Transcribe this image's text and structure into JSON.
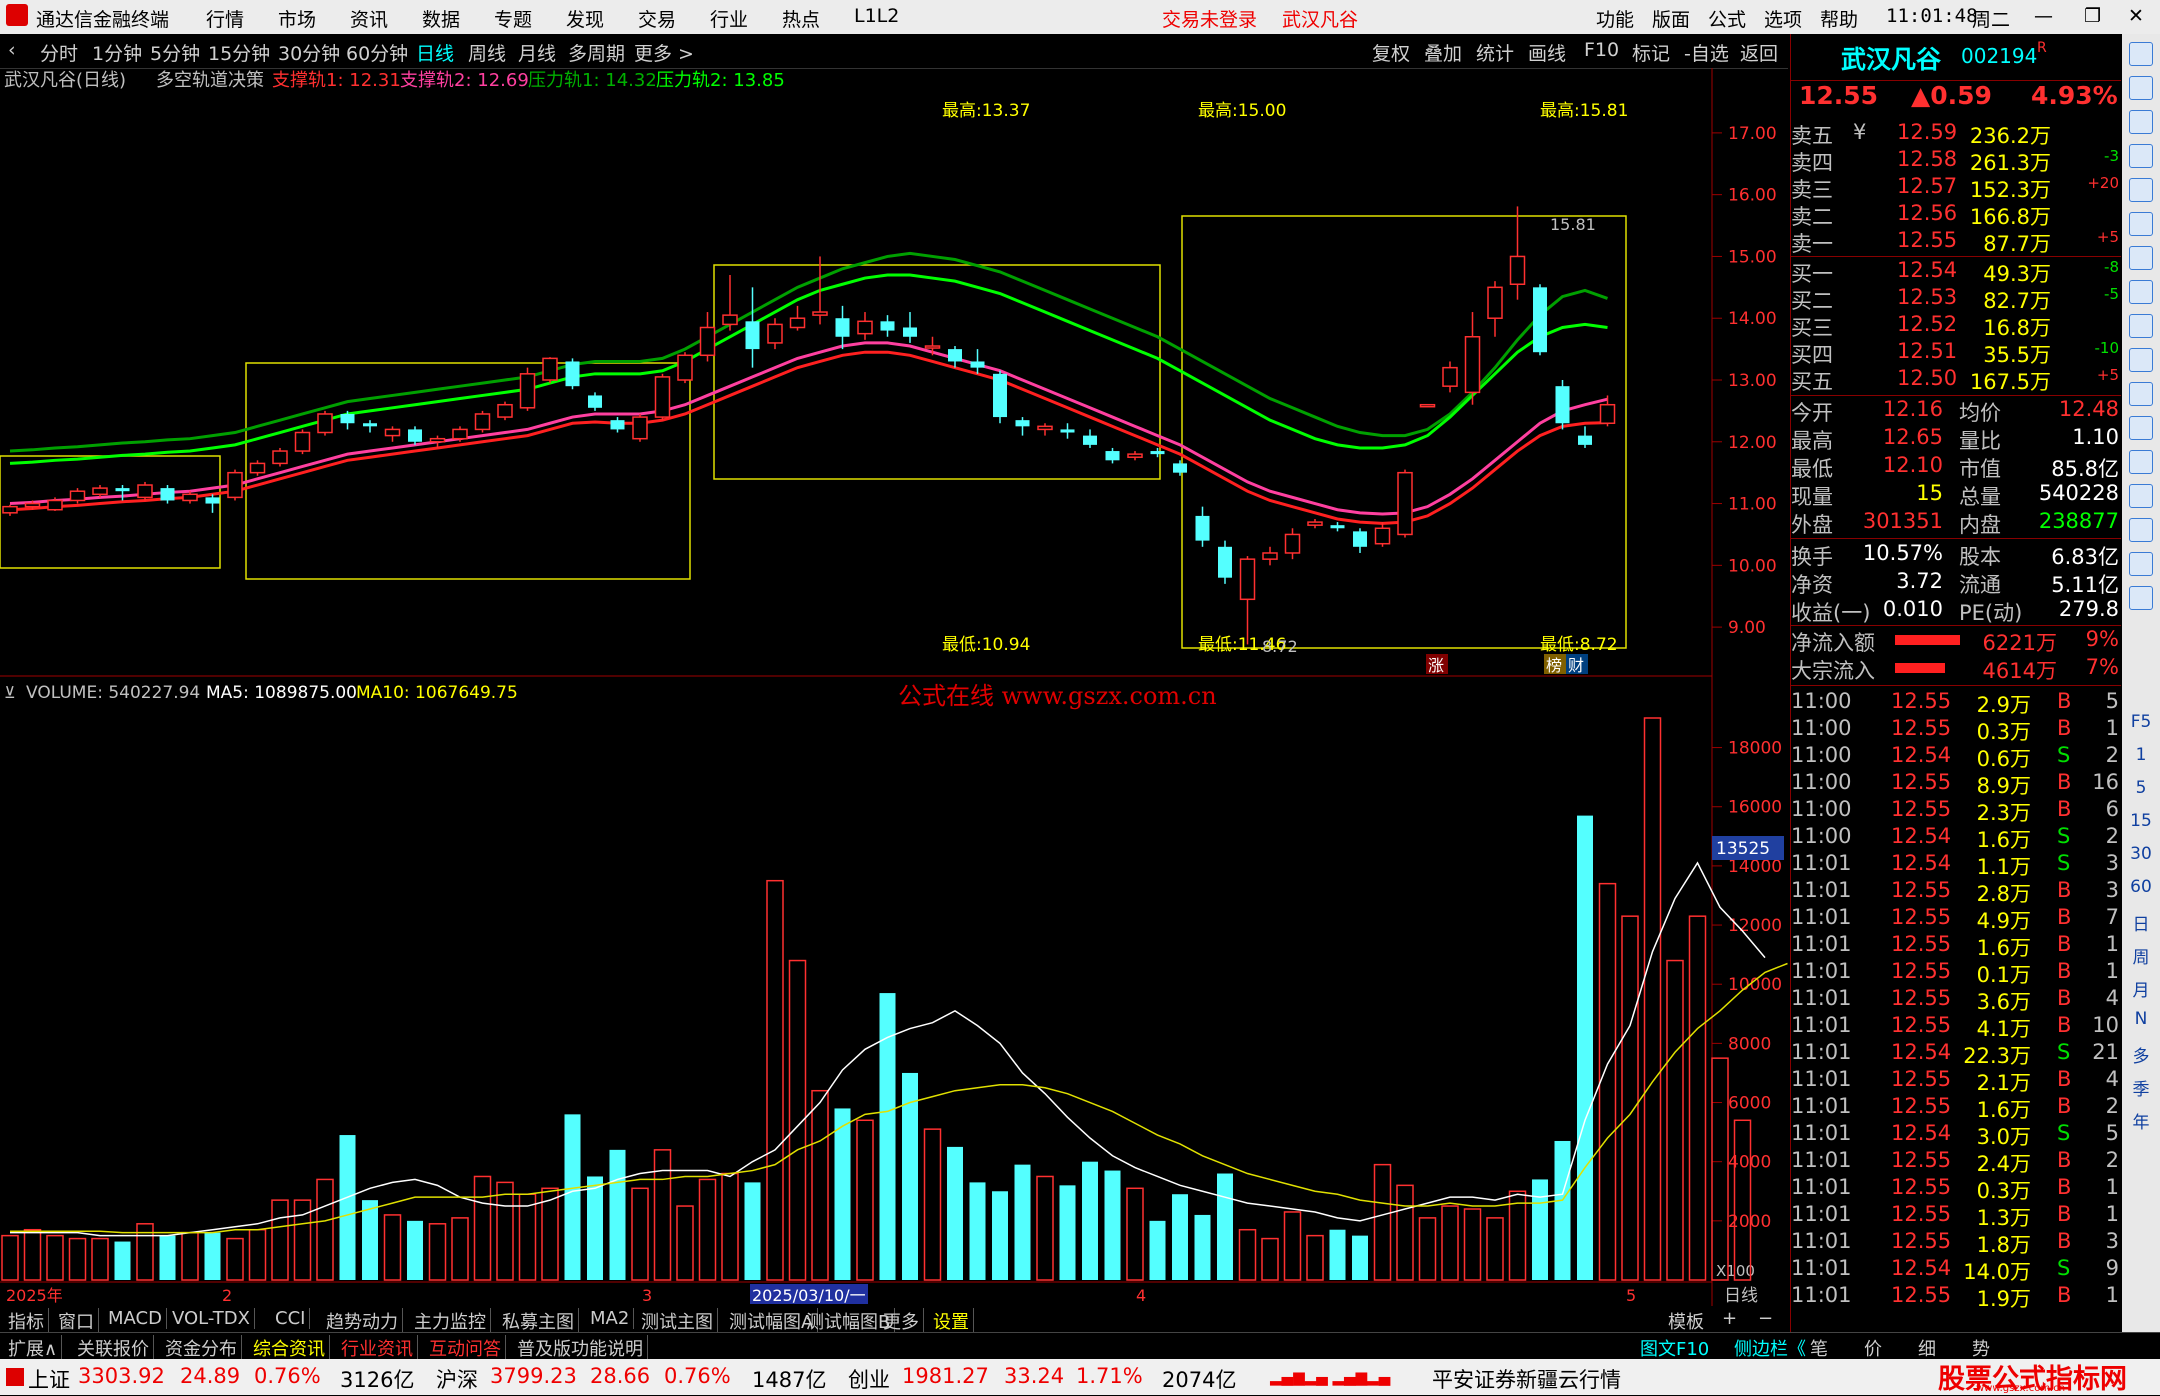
{
  "titlebar": {
    "app_name": "通达信金融终端",
    "menus": [
      "行情",
      "市场",
      "资讯",
      "数据",
      "专题",
      "发现",
      "交易",
      "行业",
      "热点",
      "L1L2"
    ],
    "trade_status": "交易未登录",
    "stock_name": "武汉凡谷",
    "right_menus": [
      "功能",
      "版面",
      "公式",
      "选项",
      "帮助"
    ],
    "time": "11:01:48",
    "weekday": "周二"
  },
  "periods": [
    "分时",
    "1分钟",
    "5分钟",
    "15分钟",
    "30分钟",
    "60分钟",
    "日线",
    "周线",
    "月线",
    "多周期",
    "更多 >"
  ],
  "active_period": "日线",
  "toolbar_right": [
    "复权",
    "叠加",
    "统计",
    "画线",
    "F10",
    "标记",
    "-自选",
    "返回"
  ],
  "chart_header": {
    "name": "武汉凡谷(日线)",
    "indicator": "多空轨道决策",
    "s1": "支撑轨1: 12.31",
    "s2": "支撑轨2: 12.69",
    "p1": "压力轨1: 14.32",
    "p2": "压力轨2: 13.85"
  },
  "annotations": {
    "high1": "最高:13.37",
    "high2": "最高:15.00",
    "high3": "最高:15.81",
    "low1": "最低:10.94",
    "low2": "最低:11.46",
    "low3": "最低:8.72",
    "peak_label": "15.81",
    "low_label": "8.72",
    "badge_zhang": "涨",
    "badge_bang": "榜",
    "badge_cai": "财"
  },
  "price_axis": [
    "17.00",
    "16.00",
    "15.00",
    "14.00",
    "13.00",
    "12.00",
    "11.00",
    "10.00",
    "9.00"
  ],
  "volume_header": {
    "vol": "VOLUME: 540227.94",
    "ma5": "MA5: 1089875.00",
    "ma10": "MA10: 1067649.75"
  },
  "watermark": "公式在线  www.gszx.com.cn",
  "volume_axis": [
    "18000",
    "16000",
    "14000",
    "12000",
    "10000",
    "8000",
    "6000",
    "4000",
    "2000"
  ],
  "volume_marker": "13525",
  "volume_unit": "X100",
  "date_axis": {
    "d0": "2025年",
    "d1": "2",
    "d2": "3",
    "d3": "2025/03/10/一",
    "d4": "4",
    "d5": "5",
    "label": "日线"
  },
  "chart_data": {
    "type": "candlestick",
    "ylim": [
      8.5,
      17.5
    ],
    "candles": [
      [
        10.85,
        10.95,
        10.8,
        10.98
      ],
      [
        10.95,
        11.0,
        10.9,
        11.05
      ],
      [
        10.9,
        11.05,
        10.88,
        11.1
      ],
      [
        11.05,
        11.2,
        11.0,
        11.25
      ],
      [
        11.15,
        11.25,
        11.1,
        11.3
      ],
      [
        11.25,
        11.2,
        11.05,
        11.3
      ],
      [
        11.1,
        11.3,
        11.05,
        11.35
      ],
      [
        11.25,
        11.05,
        11.0,
        11.3
      ],
      [
        11.05,
        11.15,
        11.0,
        11.2
      ],
      [
        11.1,
        11.0,
        10.85,
        11.15
      ],
      [
        11.1,
        11.5,
        11.05,
        11.55
      ],
      [
        11.5,
        11.65,
        11.45,
        11.7
      ],
      [
        11.65,
        11.85,
        11.6,
        11.9
      ],
      [
        11.85,
        12.15,
        11.8,
        12.2
      ],
      [
        12.15,
        12.45,
        12.1,
        12.5
      ],
      [
        12.45,
        12.3,
        12.2,
        12.5
      ],
      [
        12.3,
        12.25,
        12.15,
        12.35
      ],
      [
        12.1,
        12.2,
        12.0,
        12.25
      ],
      [
        12.2,
        12.0,
        11.95,
        12.25
      ],
      [
        12.0,
        12.05,
        11.9,
        12.1
      ],
      [
        12.05,
        12.2,
        12.0,
        12.25
      ],
      [
        12.2,
        12.45,
        12.15,
        12.5
      ],
      [
        12.4,
        12.6,
        12.35,
        12.65
      ],
      [
        12.55,
        13.1,
        12.5,
        13.2
      ],
      [
        13.0,
        13.35,
        12.95,
        13.37
      ],
      [
        13.3,
        12.9,
        12.85,
        13.35
      ],
      [
        12.75,
        12.55,
        12.5,
        12.8
      ],
      [
        12.35,
        12.2,
        12.15,
        12.4
      ],
      [
        12.05,
        12.4,
        12.0,
        12.45
      ],
      [
        12.4,
        13.05,
        12.35,
        13.1
      ],
      [
        13.0,
        13.4,
        12.95,
        13.45
      ],
      [
        13.4,
        13.85,
        13.3,
        14.1
      ],
      [
        13.9,
        14.05,
        13.8,
        14.7
      ],
      [
        13.95,
        13.5,
        13.2,
        14.5
      ],
      [
        13.6,
        13.9,
        13.5,
        14.0
      ],
      [
        13.85,
        14.0,
        13.8,
        14.2
      ],
      [
        14.05,
        14.1,
        13.9,
        15.0
      ],
      [
        14.0,
        13.7,
        13.5,
        14.2
      ],
      [
        13.75,
        13.95,
        13.65,
        14.1
      ],
      [
        13.95,
        13.8,
        13.7,
        14.05
      ],
      [
        13.85,
        13.7,
        13.6,
        14.1
      ],
      [
        13.55,
        13.55,
        13.4,
        13.7
      ],
      [
        13.5,
        13.3,
        13.2,
        13.55
      ],
      [
        13.3,
        13.2,
        13.1,
        13.5
      ],
      [
        13.1,
        12.4,
        12.3,
        13.15
      ],
      [
        12.35,
        12.25,
        12.1,
        12.4
      ],
      [
        12.2,
        12.25,
        12.1,
        12.3
      ],
      [
        12.2,
        12.15,
        12.05,
        12.3
      ],
      [
        12.1,
        11.95,
        11.9,
        12.2
      ],
      [
        11.85,
        11.7,
        11.65,
        11.9
      ],
      [
        11.75,
        11.8,
        11.7,
        11.85
      ],
      [
        11.85,
        11.8,
        11.75,
        11.9
      ],
      [
        11.65,
        11.5,
        11.45,
        11.7
      ],
      [
        10.8,
        10.4,
        10.3,
        10.95
      ],
      [
        10.3,
        9.8,
        9.7,
        10.4
      ],
      [
        9.45,
        10.1,
        8.72,
        10.15
      ],
      [
        10.1,
        10.2,
        10.0,
        10.3
      ],
      [
        10.2,
        10.5,
        10.1,
        10.6
      ],
      [
        10.65,
        10.7,
        10.6,
        10.75
      ],
      [
        10.65,
        10.6,
        10.55,
        10.7
      ],
      [
        10.55,
        10.3,
        10.2,
        10.6
      ],
      [
        10.35,
        10.6,
        10.3,
        10.7
      ],
      [
        10.5,
        11.5,
        10.45,
        11.55
      ],
      [
        12.6,
        12.6,
        12.6,
        12.6
      ],
      [
        12.9,
        13.2,
        12.8,
        13.3
      ],
      [
        12.8,
        13.7,
        12.6,
        14.1
      ],
      [
        14.0,
        14.5,
        13.7,
        14.6
      ],
      [
        14.55,
        15.0,
        14.3,
        15.81
      ],
      [
        14.5,
        13.45,
        13.4,
        14.55
      ],
      [
        12.9,
        12.3,
        12.2,
        13.0
      ],
      [
        12.1,
        11.95,
        11.9,
        12.25
      ],
      [
        12.3,
        12.6,
        12.25,
        12.75
      ]
    ],
    "support1": [
      10.9,
      10.92,
      10.95,
      10.97,
      11.0,
      11.03,
      11.05,
      11.08,
      11.1,
      11.15,
      11.2,
      11.3,
      11.4,
      11.5,
      11.6,
      11.7,
      11.75,
      11.8,
      11.85,
      11.9,
      11.95,
      12.0,
      12.05,
      12.1,
      12.2,
      12.3,
      12.32,
      12.3,
      12.3,
      12.35,
      12.45,
      12.6,
      12.75,
      12.9,
      13.05,
      13.2,
      13.3,
      13.4,
      13.45,
      13.45,
      13.4,
      13.3,
      13.2,
      13.1,
      13.0,
      12.85,
      12.7,
      12.55,
      12.4,
      12.25,
      12.1,
      11.95,
      11.8,
      11.6,
      11.4,
      11.2,
      11.05,
      10.95,
      10.85,
      10.75,
      10.7,
      10.68,
      10.7,
      10.8,
      11.0,
      11.25,
      11.55,
      11.85,
      12.1,
      12.25,
      12.3,
      12.31
    ],
    "support2": [
      11.0,
      11.02,
      11.05,
      11.07,
      11.1,
      11.12,
      11.15,
      11.18,
      11.2,
      11.25,
      11.3,
      11.4,
      11.5,
      11.6,
      11.7,
      11.8,
      11.85,
      11.9,
      11.95,
      12.0,
      12.05,
      12.1,
      12.15,
      12.2,
      12.3,
      12.4,
      12.45,
      12.45,
      12.45,
      12.5,
      12.6,
      12.75,
      12.9,
      13.05,
      13.2,
      13.35,
      13.45,
      13.55,
      13.6,
      13.6,
      13.55,
      13.45,
      13.35,
      13.25,
      13.15,
      13.0,
      12.85,
      12.7,
      12.55,
      12.4,
      12.25,
      12.1,
      11.95,
      11.75,
      11.55,
      11.35,
      11.2,
      11.1,
      11.0,
      10.9,
      10.85,
      10.83,
      10.85,
      10.95,
      11.15,
      11.4,
      11.7,
      12.0,
      12.3,
      12.5,
      12.6,
      12.69
    ],
    "pressure1": [
      11.85,
      11.87,
      11.9,
      11.92,
      11.95,
      11.98,
      12.0,
      12.03,
      12.05,
      12.1,
      12.15,
      12.25,
      12.35,
      12.45,
      12.55,
      12.65,
      12.7,
      12.75,
      12.8,
      12.85,
      12.9,
      12.95,
      13.0,
      13.05,
      13.15,
      13.25,
      13.3,
      13.3,
      13.3,
      13.35,
      13.5,
      13.7,
      13.9,
      14.1,
      14.3,
      14.5,
      14.65,
      14.8,
      14.9,
      15.0,
      15.05,
      15.0,
      14.95,
      14.85,
      14.75,
      14.6,
      14.45,
      14.3,
      14.15,
      14.0,
      13.85,
      13.7,
      13.5,
      13.3,
      13.1,
      12.9,
      12.7,
      12.55,
      12.4,
      12.25,
      12.15,
      12.1,
      12.1,
      12.2,
      12.45,
      12.8,
      13.2,
      13.65,
      14.05,
      14.35,
      14.45,
      14.32
    ],
    "pressure2": [
      11.65,
      11.67,
      11.7,
      11.72,
      11.75,
      11.78,
      11.8,
      11.83,
      11.85,
      11.9,
      11.95,
      12.05,
      12.15,
      12.25,
      12.35,
      12.45,
      12.5,
      12.55,
      12.6,
      12.65,
      12.7,
      12.75,
      12.8,
      12.85,
      12.95,
      13.05,
      13.1,
      13.1,
      13.1,
      13.15,
      13.3,
      13.5,
      13.7,
      13.9,
      14.1,
      14.3,
      14.45,
      14.55,
      14.65,
      14.7,
      14.7,
      14.65,
      14.6,
      14.5,
      14.4,
      14.25,
      14.1,
      13.95,
      13.8,
      13.65,
      13.5,
      13.35,
      13.15,
      12.95,
      12.75,
      12.55,
      12.35,
      12.2,
      12.05,
      11.95,
      11.9,
      11.9,
      11.95,
      12.1,
      12.4,
      12.75,
      13.1,
      13.45,
      13.7,
      13.85,
      13.9,
      13.85
    ],
    "volume_ylim": [
      0,
      19000
    ],
    "volumes": [
      1500,
      1700,
      1500,
      1400,
      1400,
      1300,
      1900,
      1500,
      1600,
      1600,
      1400,
      1700,
      2700,
      2700,
      3400,
      4900,
      2700,
      2200,
      2000,
      1900,
      2100,
      3500,
      3300,
      2900,
      3100,
      5600,
      3500,
      4400,
      3100,
      4400,
      2500,
      3400,
      3600,
      3300,
      13500,
      10800,
      6400,
      5800,
      5400,
      9700,
      7000,
      5100,
      4500,
      3300,
      3000,
      3900,
      3500,
      3200,
      4000,
      3700,
      3100,
      2000,
      2900,
      2200,
      3600,
      1700,
      1400,
      2300,
      1500,
      1700,
      1500,
      3900,
      3200,
      2100,
      2500,
      2400,
      2100,
      3000,
      3400,
      4700,
      15700,
      13400,
      12300,
      19000,
      10800,
      12300,
      7500,
      5400
    ],
    "ma5": [
      1600,
      1600,
      1600,
      1600,
      1500,
      1500,
      1500,
      1500,
      1600,
      1700,
      1800,
      1900,
      2100,
      2200,
      2500,
      2800,
      3100,
      3300,
      3400,
      3200,
      2800,
      2600,
      2500,
      2500,
      2700,
      3000,
      3100,
      3400,
      3600,
      3700,
      3700,
      3700,
      3500,
      4000,
      4400,
      5200,
      6000,
      7100,
      7800,
      8200,
      8500,
      8700,
      9100,
      8600,
      8000,
      7000,
      6300,
      5500,
      4800,
      4200,
      3800,
      3500,
      3200,
      3000,
      2800,
      2600,
      2500,
      2400,
      2300,
      2100,
      2000,
      2200,
      2400,
      2600,
      2800,
      2800,
      2700,
      2900,
      2800,
      2900,
      5400,
      7300,
      8600,
      11100,
      12900,
      14100,
      12600,
      11800,
      10900
    ],
    "ma10": [
      1650,
      1650,
      1650,
      1650,
      1650,
      1600,
      1600,
      1600,
      1600,
      1600,
      1700,
      1700,
      1800,
      1900,
      2000,
      2200,
      2400,
      2600,
      2800,
      2800,
      2800,
      2800,
      2900,
      2900,
      3000,
      3100,
      3200,
      3300,
      3400,
      3400,
      3500,
      3500,
      3600,
      3700,
      3900,
      4400,
      4700,
      5200,
      5600,
      5700,
      6000,
      6200,
      6400,
      6500,
      6600,
      6600,
      6500,
      6300,
      6000,
      5700,
      5300,
      4900,
      4600,
      4200,
      3900,
      3600,
      3400,
      3200,
      3000,
      2900,
      2700,
      2600,
      2500,
      2500,
      2600,
      2500,
      2500,
      2600,
      2600,
      2700,
      3800,
      4800,
      5600,
      6700,
      7700,
      8500,
      9100,
      9800,
      10400,
      10700
    ]
  },
  "quote": {
    "name": "武汉凡谷",
    "code": "002194",
    "r": "R",
    "price": "12.55",
    "change": "▲0.59",
    "pct": "4.93%",
    "asks": [
      {
        "label": "卖五",
        "sym": "¥",
        "price": "12.59",
        "vol": "236.2万",
        "chg": ""
      },
      {
        "label": "卖四",
        "sym": "",
        "price": "12.58",
        "vol": "261.3万",
        "chg": "-3"
      },
      {
        "label": "卖三",
        "sym": "",
        "price": "12.57",
        "vol": "152.3万",
        "chg": "+20"
      },
      {
        "label": "卖二",
        "sym": "",
        "price": "12.56",
        "vol": "166.8万",
        "chg": ""
      },
      {
        "label": "卖一",
        "sym": "",
        "price": "12.55",
        "vol": "87.7万",
        "chg": "+5"
      }
    ],
    "bids": [
      {
        "label": "买一",
        "sym": "",
        "price": "12.54",
        "vol": "49.3万",
        "chg": "-8"
      },
      {
        "label": "买二",
        "sym": "",
        "price": "12.53",
        "vol": "82.7万",
        "chg": "-5"
      },
      {
        "label": "买三",
        "sym": "",
        "price": "12.52",
        "vol": "16.8万",
        "chg": ""
      },
      {
        "label": "买四",
        "sym": "",
        "price": "12.51",
        "vol": "35.5万",
        "chg": "-10"
      },
      {
        "label": "买五",
        "sym": "",
        "price": "12.50",
        "vol": "167.5万",
        "chg": "+5"
      }
    ],
    "stats": [
      [
        "今开",
        "12.16",
        "均价",
        "12.48"
      ],
      [
        "最高",
        "12.65",
        "量比",
        "1.10"
      ],
      [
        "最低",
        "12.10",
        "市值",
        "85.8亿"
      ],
      [
        "现量",
        "15",
        "总量",
        "540228"
      ],
      [
        "外盘",
        "301351",
        "内盘",
        "238877"
      ],
      [
        "换手",
        "10.57%",
        "股本",
        "6.83亿"
      ],
      [
        "净资",
        "3.72",
        "流通",
        "5.11亿"
      ],
      [
        "收益(一)",
        "0.010",
        "PE(动)",
        "279.8"
      ]
    ],
    "flows": [
      {
        "label": "净流入额",
        "val": "6221万",
        "pct": "9%",
        "bar": 0.9
      },
      {
        "label": "大宗流入",
        "val": "4614万",
        "pct": "7%",
        "bar": 0.7
      }
    ],
    "ticks": [
      [
        "11:00",
        "12.55",
        "2.9万",
        "B",
        "5"
      ],
      [
        "11:00",
        "12.55",
        "0.3万",
        "B",
        "1"
      ],
      [
        "11:00",
        "12.54",
        "0.6万",
        "S",
        "2"
      ],
      [
        "11:00",
        "12.55",
        "8.9万",
        "B",
        "16"
      ],
      [
        "11:00",
        "12.55",
        "2.3万",
        "B",
        "6"
      ],
      [
        "11:00",
        "12.54",
        "1.6万",
        "S",
        "2"
      ],
      [
        "11:01",
        "12.54",
        "1.1万",
        "S",
        "3"
      ],
      [
        "11:01",
        "12.55",
        "2.8万",
        "B",
        "3"
      ],
      [
        "11:01",
        "12.55",
        "4.9万",
        "B",
        "7"
      ],
      [
        "11:01",
        "12.55",
        "1.6万",
        "B",
        "1"
      ],
      [
        "11:01",
        "12.55",
        "0.1万",
        "B",
        "1"
      ],
      [
        "11:01",
        "12.55",
        "3.6万",
        "B",
        "4"
      ],
      [
        "11:01",
        "12.55",
        "4.1万",
        "B",
        "10"
      ],
      [
        "11:01",
        "12.54",
        "22.3万",
        "S",
        "21"
      ],
      [
        "11:01",
        "12.55",
        "2.1万",
        "B",
        "4"
      ],
      [
        "11:01",
        "12.55",
        "1.6万",
        "B",
        "2"
      ],
      [
        "11:01",
        "12.54",
        "3.0万",
        "S",
        "5"
      ],
      [
        "11:01",
        "12.55",
        "2.4万",
        "B",
        "2"
      ],
      [
        "11:01",
        "12.55",
        "0.3万",
        "B",
        "1"
      ],
      [
        "11:01",
        "12.55",
        "1.3万",
        "B",
        "1"
      ],
      [
        "11:01",
        "12.55",
        "1.8万",
        "B",
        "3"
      ],
      [
        "11:01",
        "12.54",
        "14.0万",
        "S",
        "9"
      ],
      [
        "11:01",
        "12.55",
        "1.9万",
        "B",
        "1"
      ]
    ]
  },
  "bottom_tabs": [
    "指标",
    "窗口",
    "MACD",
    "VOL-TDX",
    "CCI",
    "趋势动力",
    "主力监控",
    "私募主图",
    "MA2",
    "测试主图",
    "测试幅图A",
    "测试幅图B",
    "更多",
    "设置"
  ],
  "bottom_right": [
    "模板",
    "+",
    "−"
  ],
  "bottom2_tabs": [
    "扩展∧",
    "关联报价",
    "资金分布",
    "综合资讯",
    "行业资讯",
    "互动问答",
    "普及版功能说明"
  ],
  "bottom2_right": [
    "图文F10",
    "侧边栏《",
    "笔",
    "价",
    "细",
    "势"
  ],
  "status": {
    "sh_label": "上证",
    "sh": "3303.92",
    "sh_chg": "24.89",
    "sh_pct": "0.76%",
    "sh_amt": "3126亿",
    "hs_label": "沪深",
    "hs": "3799.23",
    "hs_chg": "28.66",
    "hs_pct": "0.76%",
    "hs_amt": "1487亿",
    "cy_label": "创业",
    "cy": "1981.27",
    "cy_chg": "33.24",
    "cy_pct": "1.71%",
    "cy_amt": "2074亿",
    "broker": "平安证券新疆云行情",
    "logo": "股票公式指标网",
    "logo_url": "www.gszx.com.cn"
  },
  "right_tools": [
    "F5",
    "1",
    "5",
    "15",
    "30",
    "60",
    "日",
    "周",
    "月",
    "N",
    "多",
    "季",
    "年"
  ]
}
